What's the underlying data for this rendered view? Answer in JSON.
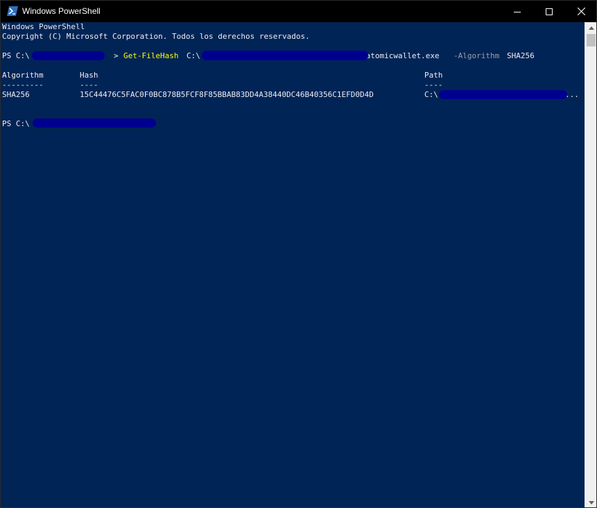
{
  "window": {
    "title": "Windows PowerShell",
    "background_color": "#012456",
    "icons": {
      "app": "powershell-icon",
      "minimize": "minimize-icon",
      "maximize": "maximize-icon",
      "close": "close-icon"
    }
  },
  "console": {
    "header_line1": "Windows PowerShell",
    "header_line2": "Copyright (C) Microsoft Corporation. Todos los derechos reservados.",
    "prompt1": {
      "prefix": "PS C:\\",
      "suffix": ">",
      "command": "Get-FileHash",
      "path_prefix": "C:\\",
      "path_suffix": "\\atomicwallet.exe",
      "param": "-Algorithm",
      "param_value": "SHA256"
    },
    "table": {
      "headers": [
        "Algorithm",
        "Hash",
        "Path"
      ],
      "separators": [
        "---------",
        "----",
        "----"
      ],
      "rows": [
        {
          "algorithm": "SHA256",
          "hash": "15C44476C5FAC0F0BC878B5FCF8F85BBAB83DD4A38440DC46B40356C1EFD0D4D",
          "path_prefix": "C:\\",
          "path_suffix": "..."
        }
      ]
    },
    "prompt2": {
      "prefix": "PS C:\\"
    }
  },
  "colors": {
    "console_bg": "#012456",
    "console_text": "#eeedf0",
    "command": "#ffff00",
    "parameter": "#9aa0a6",
    "redaction": "#00008f"
  }
}
